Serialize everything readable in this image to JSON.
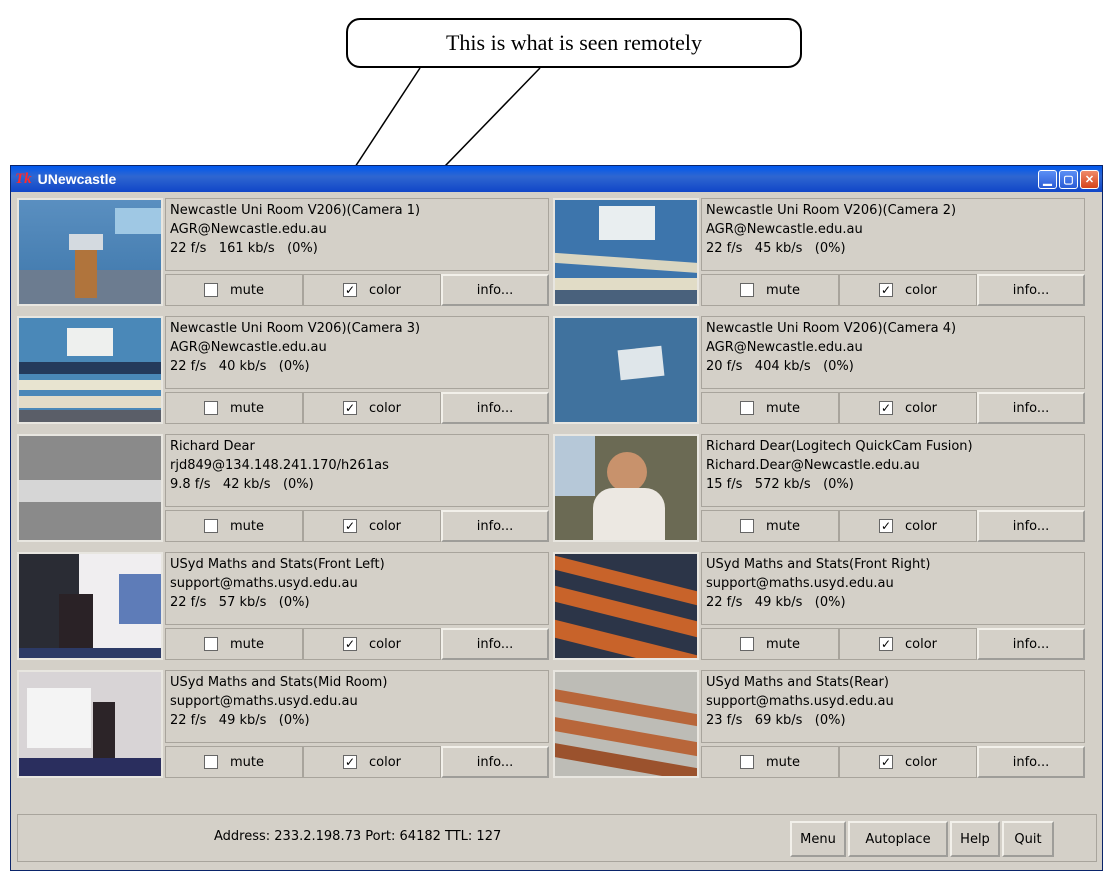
{
  "callout": {
    "text": "This is what is seen remotely"
  },
  "window": {
    "title": "UNewcastle",
    "logo": "Tk"
  },
  "streams": [
    {
      "name": "Newcastle Uni Room V206)(Camera 1)",
      "addr": "AGR@Newcastle.edu.au",
      "stats": "22 f/s   161 kb/s   (0%)",
      "mute": false,
      "color": true,
      "thumb": "thumb-a"
    },
    {
      "name": "Newcastle Uni Room V206)(Camera 2)",
      "addr": "AGR@Newcastle.edu.au",
      "stats": "22 f/s   45 kb/s   (0%)",
      "mute": false,
      "color": true,
      "thumb": "thumb-b"
    },
    {
      "name": "Newcastle Uni Room V206)(Camera 3)",
      "addr": "AGR@Newcastle.edu.au",
      "stats": "22 f/s   40 kb/s   (0%)",
      "mute": false,
      "color": true,
      "thumb": "thumb-c"
    },
    {
      "name": "Newcastle Uni Room V206)(Camera 4)",
      "addr": "AGR@Newcastle.edu.au",
      "stats": "20 f/s   404 kb/s   (0%)",
      "mute": false,
      "color": true,
      "thumb": "thumb-d"
    },
    {
      "name": "Richard Dear",
      "addr": "rjd849@134.148.241.170/h261as",
      "stats": "9.8 f/s   42 kb/s   (0%)",
      "mute": false,
      "color": true,
      "thumb": "thumb-e"
    },
    {
      "name": "Richard Dear(Logitech QuickCam Fusion)",
      "addr": "Richard.Dear@Newcastle.edu.au",
      "stats": "15 f/s   572 kb/s   (0%)",
      "mute": false,
      "color": true,
      "thumb": "thumb-f"
    },
    {
      "name": "USyd Maths and Stats(Front Left)",
      "addr": "support@maths.usyd.edu.au",
      "stats": "22 f/s   57 kb/s   (0%)",
      "mute": false,
      "color": true,
      "thumb": "thumb-g"
    },
    {
      "name": "USyd Maths and Stats(Front Right)",
      "addr": "support@maths.usyd.edu.au",
      "stats": "22 f/s   49 kb/s   (0%)",
      "mute": false,
      "color": true,
      "thumb": "thumb-h"
    },
    {
      "name": "USyd Maths and Stats(Mid Room)",
      "addr": "support@maths.usyd.edu.au",
      "stats": "22 f/s   49 kb/s   (0%)",
      "mute": false,
      "color": true,
      "thumb": "thumb-i"
    },
    {
      "name": "USyd Maths and Stats(Rear)",
      "addr": "support@maths.usyd.edu.au",
      "stats": "23 f/s   69 kb/s   (0%)",
      "mute": false,
      "color": true,
      "thumb": "thumb-j"
    }
  ],
  "labels": {
    "mute": "mute",
    "color": "color",
    "info": "info..."
  },
  "status": {
    "address": "Address: 233.2.198.73  Port: 64182  TTL: 127",
    "buttons": [
      "Menu",
      "Autoplace",
      "Help",
      "Quit"
    ]
  },
  "colors": {
    "titlebar": "#0058ee",
    "panel": "#d4d0c8"
  }
}
